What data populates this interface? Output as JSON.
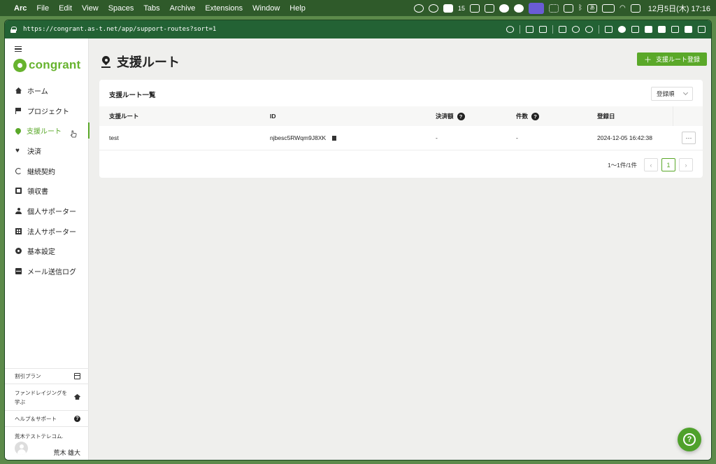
{
  "menubar": {
    "app": "Arc",
    "items": [
      "File",
      "Edit",
      "View",
      "Spaces",
      "Tabs",
      "Archive",
      "Extensions",
      "Window",
      "Help"
    ],
    "badge_count": "15",
    "input_method": "あ",
    "clock": "12月5日(木)  17:16"
  },
  "browser": {
    "url": "https://congrant.as-t.net/app/support-routes?sort=1"
  },
  "sidebar": {
    "logo": "congrant",
    "items": [
      {
        "label": "ホーム",
        "icon": "home-icon"
      },
      {
        "label": "プロジェクト",
        "icon": "flag-icon"
      },
      {
        "label": "支援ルート",
        "icon": "map-pin-icon",
        "active": true
      },
      {
        "label": "決済",
        "icon": "heart-icon"
      },
      {
        "label": "継続契約",
        "icon": "refresh-icon"
      },
      {
        "label": "領収書",
        "icon": "receipt-icon"
      },
      {
        "label": "個人サポーター",
        "icon": "person-icon"
      },
      {
        "label": "法人サポーター",
        "icon": "building-icon"
      },
      {
        "label": "基本設定",
        "icon": "gear-icon"
      },
      {
        "label": "メール送信ログ",
        "icon": "mail-icon"
      }
    ],
    "bottom": {
      "plan": "割引プラン",
      "learn": "ファンドレイジングを学ぶ",
      "help": "ヘルプ＆サポート",
      "org": "荒木テストテレコム.",
      "user": "荒木 雄大"
    }
  },
  "main": {
    "title": "支援ルート",
    "add_button": "支援ルート登録",
    "card_title": "支援ルート一覧",
    "sort_select": "登録順",
    "columns": [
      "支援ルート",
      "ID",
      "決済額",
      "件数",
      "登録日"
    ],
    "rows": [
      {
        "name": "test",
        "id": "njbesc5RWqm9J8XK",
        "amount": "-",
        "count": "-",
        "date": "2024-12-05 16:42:38",
        "more": "···"
      }
    ],
    "pagination": {
      "summary": "1〜1件/1件",
      "prev": "‹",
      "current": "1",
      "next": "›"
    }
  },
  "colors": {
    "accent": "#5aa829",
    "url_bar": "#236234"
  }
}
